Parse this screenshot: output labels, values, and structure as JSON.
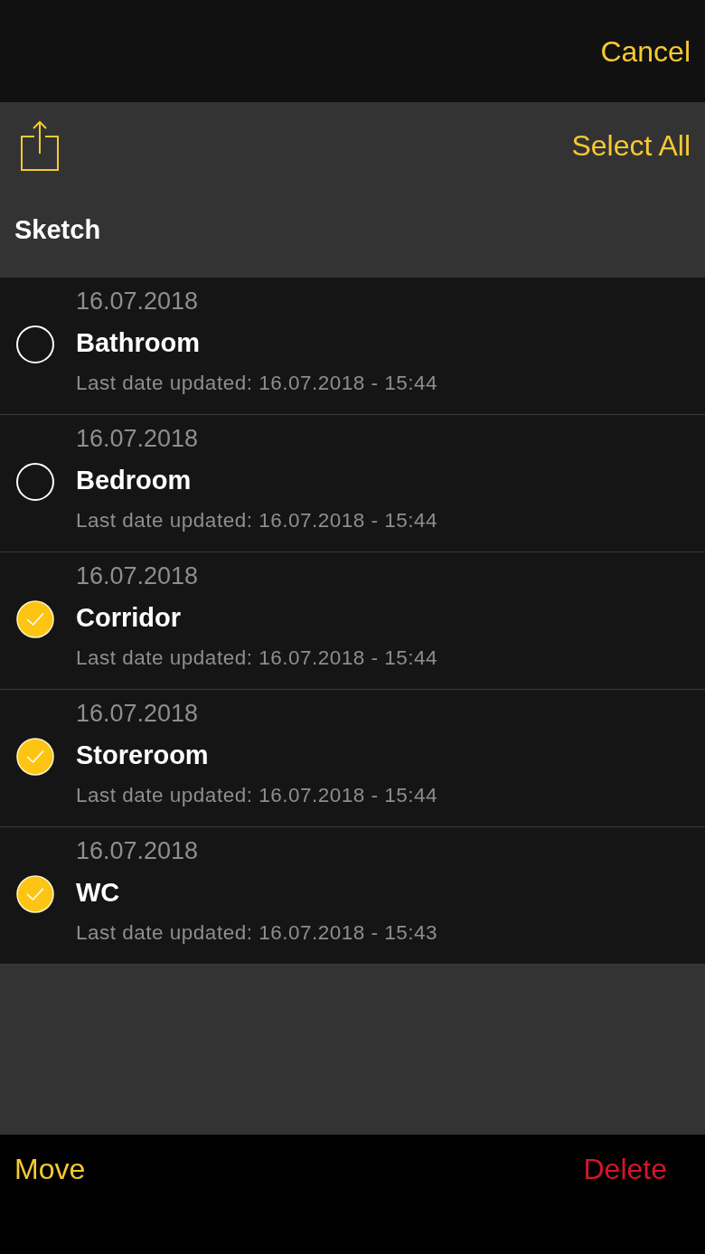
{
  "top_bar": {
    "cancel": "Cancel"
  },
  "header": {
    "select_all": "Select All",
    "title": "Sketch"
  },
  "items": [
    {
      "date": "16.07.2018",
      "name": "Bathroom",
      "updated": "Last date updated: 16.07.2018 - 15:44",
      "selected": false
    },
    {
      "date": "16.07.2018",
      "name": "Bedroom",
      "updated": "Last date updated: 16.07.2018 - 15:44",
      "selected": false
    },
    {
      "date": "16.07.2018",
      "name": "Corridor",
      "updated": "Last date updated: 16.07.2018 - 15:44",
      "selected": true
    },
    {
      "date": "16.07.2018",
      "name": "Storeroom",
      "updated": "Last date updated: 16.07.2018 - 15:44",
      "selected": true
    },
    {
      "date": "16.07.2018",
      "name": "WC",
      "updated": "Last date updated: 16.07.2018 - 15:43",
      "selected": true
    }
  ],
  "toolbar": {
    "move": "Move",
    "delete": "Delete"
  }
}
